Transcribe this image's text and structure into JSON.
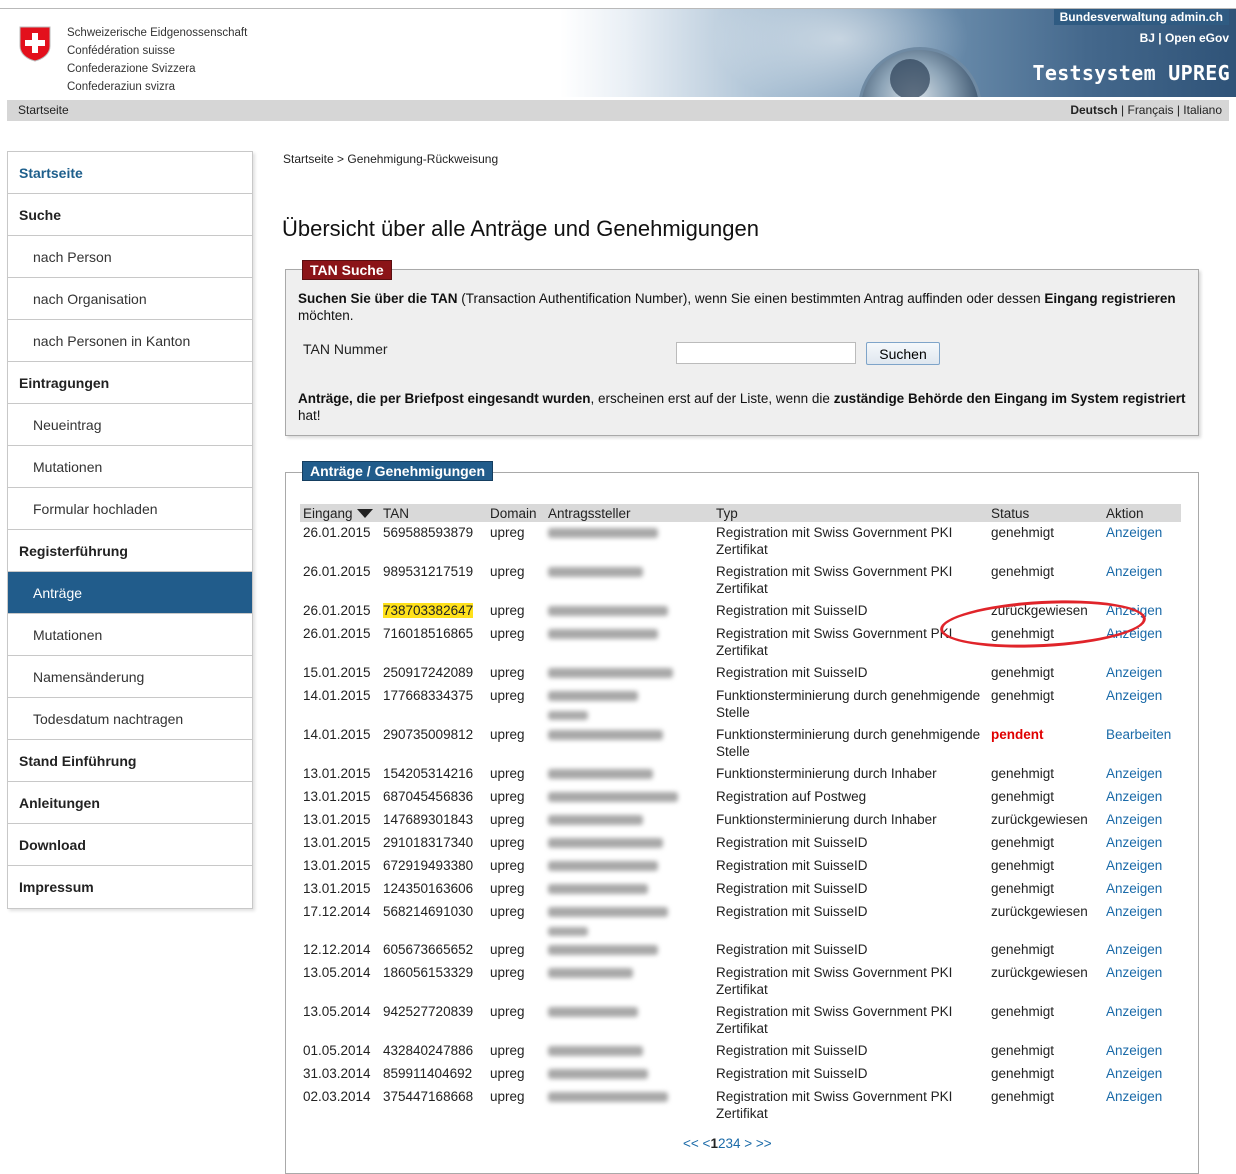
{
  "header": {
    "country_names": [
      "Schweizerische Eidgenossenschaft",
      "Confédération suisse",
      "Confederazione Svizzera",
      "Confederaziun svizra"
    ],
    "federal_link": "Bundesverwaltung admin.ch",
    "bj_link": "BJ | Open eGov",
    "app_title": "Testsystem UPREG",
    "nav_home": "Startseite",
    "languages": {
      "active": "Deutsch",
      "sep1": " | ",
      "fr": "Français",
      "sep2": " | ",
      "it": "Italiano"
    }
  },
  "sidebar": {
    "items": [
      {
        "label": "Startseite"
      },
      {
        "label": "Suche"
      },
      {
        "label": "nach Person"
      },
      {
        "label": "nach Organisation"
      },
      {
        "label": "nach Personen in Kanton"
      },
      {
        "label": "Eintragungen"
      },
      {
        "label": "Neueintrag"
      },
      {
        "label": "Mutationen"
      },
      {
        "label": "Formular hochladen"
      },
      {
        "label": "Registerführung"
      },
      {
        "label": "Anträge"
      },
      {
        "label": "Mutationen"
      },
      {
        "label": "Namensänderung"
      },
      {
        "label": "Todesdatum nachtragen"
      },
      {
        "label": "Stand Einführung"
      },
      {
        "label": "Anleitungen"
      },
      {
        "label": "Download"
      },
      {
        "label": "Impressum"
      }
    ]
  },
  "breadcrumb": {
    "home": "Startseite",
    "sep": " > ",
    "current": "Genehmigung-Rückweisung"
  },
  "page_title": "Übersicht über alle Anträge und Genehmigungen",
  "tan": {
    "legend": "TAN Suche",
    "intro_b1": "Suchen Sie über die TAN",
    "intro_t1": " (Transaction Authentification Number), wenn Sie einen bestimmten Antrag auffinden oder dessen ",
    "intro_b2": "Eingang registrieren",
    "intro_t2": " möchten.",
    "label": "TAN Nummer",
    "input_value": "",
    "button": "Suchen",
    "note_b1": "Anträge, die per Briefpost eingesandt wurden",
    "note_t1": ", erscheinen erst auf der Liste, wenn die ",
    "note_b2": "zuständige Behörde den Eingang im System registriert",
    "note_t2": " hat!"
  },
  "applications": {
    "legend": "Anträge / Genehmigungen",
    "columns": [
      "Eingang",
      "TAN",
      "Domain",
      "Antragssteller",
      "Typ",
      "Status",
      "Aktion"
    ],
    "rows": [
      {
        "date": "26.01.2015",
        "tan": "569588593879",
        "domain": "upreg",
        "type": "Registration mit Swiss Government PKI Zertifikat",
        "status": "genehmigt",
        "action": "Anzeigen"
      },
      {
        "date": "26.01.2015",
        "tan": "989531217519",
        "domain": "upreg",
        "type": "Registration mit Swiss Government PKI Zertifikat",
        "status": "genehmigt",
        "action": "Anzeigen"
      },
      {
        "date": "26.01.2015",
        "tan": "738703382647",
        "domain": "upreg",
        "type": "Registration mit SuisseID",
        "status": "zurückgewiesen",
        "action": "Anzeigen"
      },
      {
        "date": "26.01.2015",
        "tan": "716018516865",
        "domain": "upreg",
        "type": "Registration mit Swiss Government PKI Zertifikat",
        "status": "genehmigt",
        "action": "Anzeigen"
      },
      {
        "date": "15.01.2015",
        "tan": "250917242089",
        "domain": "upreg",
        "type": "Registration mit SuisseID",
        "status": "genehmigt",
        "action": "Anzeigen"
      },
      {
        "date": "14.01.2015",
        "tan": "177668334375",
        "domain": "upreg",
        "type": "Funktionsterminierung durch genehmigende Stelle",
        "status": "genehmigt",
        "action": "Anzeigen"
      },
      {
        "date": "14.01.2015",
        "tan": "290735009812",
        "domain": "upreg",
        "type": "Funktionsterminierung durch genehmigende Stelle",
        "status": "pendent",
        "action": "Bearbeiten"
      },
      {
        "date": "13.01.2015",
        "tan": "154205314216",
        "domain": "upreg",
        "type": "Funktionsterminierung durch Inhaber",
        "status": "genehmigt",
        "action": "Anzeigen"
      },
      {
        "date": "13.01.2015",
        "tan": "687045456836",
        "domain": "upreg",
        "type": "Registration auf Postweg",
        "status": "genehmigt",
        "action": "Anzeigen"
      },
      {
        "date": "13.01.2015",
        "tan": "147689301843",
        "domain": "upreg",
        "type": "Funktionsterminierung durch Inhaber",
        "status": "zurückgewiesen",
        "action": "Anzeigen"
      },
      {
        "date": "13.01.2015",
        "tan": "291018317340",
        "domain": "upreg",
        "type": "Registration mit SuisseID",
        "status": "genehmigt",
        "action": "Anzeigen"
      },
      {
        "date": "13.01.2015",
        "tan": "672919493380",
        "domain": "upreg",
        "type": "Registration mit SuisseID",
        "status": "genehmigt",
        "action": "Anzeigen"
      },
      {
        "date": "13.01.2015",
        "tan": "124350163606",
        "domain": "upreg",
        "type": "Registration mit SuisseID",
        "status": "genehmigt",
        "action": "Anzeigen"
      },
      {
        "date": "17.12.2014",
        "tan": "568214691030",
        "domain": "upreg",
        "type": "Registration mit SuisseID",
        "status": "zurückgewiesen",
        "action": "Anzeigen"
      },
      {
        "date": "12.12.2014",
        "tan": "605673665652",
        "domain": "upreg",
        "type": "Registration mit SuisseID",
        "status": "genehmigt",
        "action": "Anzeigen"
      },
      {
        "date": "13.05.2014",
        "tan": "186056153329",
        "domain": "upreg",
        "type": "Registration mit Swiss Government PKI Zertifikat",
        "status": "zurückgewiesen",
        "action": "Anzeigen"
      },
      {
        "date": "13.05.2014",
        "tan": "942527720839",
        "domain": "upreg",
        "type": "Registration mit Swiss Government PKI Zertifikat",
        "status": "genehmigt",
        "action": "Anzeigen"
      },
      {
        "date": "01.05.2014",
        "tan": "432840247886",
        "domain": "upreg",
        "type": "Registration mit SuisseID",
        "status": "genehmigt",
        "action": "Anzeigen"
      },
      {
        "date": "31.03.2014",
        "tan": "859911404692",
        "domain": "upreg",
        "type": "Registration mit SuisseID",
        "status": "genehmigt",
        "action": "Anzeigen"
      },
      {
        "date": "02.03.2014",
        "tan": "375447168668",
        "domain": "upreg",
        "type": "Registration mit Swiss Government PKI Zertifikat",
        "status": "genehmigt",
        "action": "Anzeigen"
      }
    ],
    "pager": {
      "first": "<<",
      "prev": "<",
      "current": "1",
      "p2": "2",
      "p3": "3",
      "p4": "4",
      "next": ">",
      "last": ">>"
    }
  },
  "colors": {
    "accent": "#215c8b",
    "tan_legend": "#8b1418",
    "link": "#1a6aa8",
    "pending": "#e00000",
    "highlight": "#ffe11a"
  }
}
